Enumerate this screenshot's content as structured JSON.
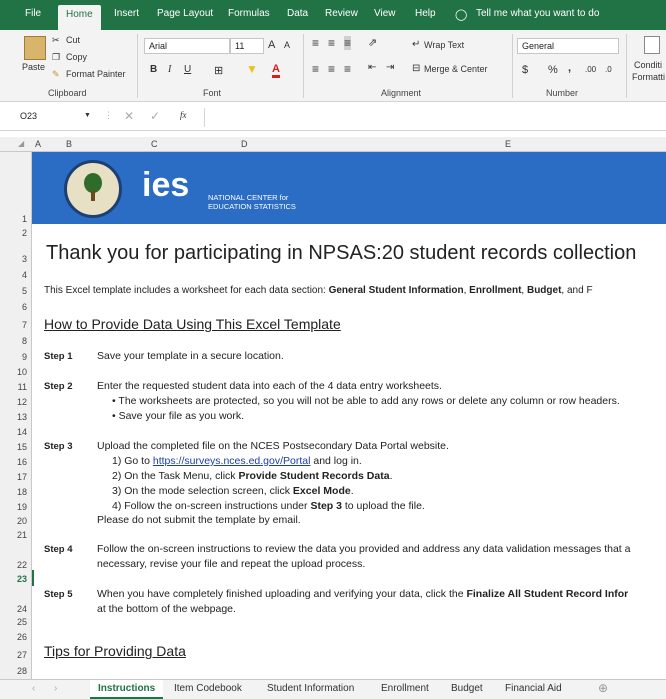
{
  "menu": {
    "tabs": [
      "File",
      "Home",
      "Insert",
      "Page Layout",
      "Formulas",
      "Data",
      "Review",
      "View",
      "Help"
    ],
    "tell_me": "Tell me what you want to do"
  },
  "ribbon": {
    "clipboard": {
      "paste": "Paste",
      "cut": "Cut",
      "copy": "Copy",
      "format_painter": "Format Painter",
      "label": "Clipboard"
    },
    "font": {
      "name": "Arial",
      "size": "11",
      "grow": "A",
      "shrink": "A",
      "bold": "B",
      "italic": "I",
      "underline": "U",
      "label": "Font"
    },
    "alignment": {
      "wrap_text": "Wrap Text",
      "merge_center": "Merge & Center",
      "label": "Alignment"
    },
    "number": {
      "format": "General",
      "currency": "$",
      "percent": "%",
      "comma": ",",
      "label": "Number"
    },
    "styles": {
      "conditional": "Conditi",
      "formatting": "Formatti"
    }
  },
  "formula_bar": {
    "cell_ref": "O23",
    "fx": "fx",
    "value": ""
  },
  "columns": [
    "A",
    "B",
    "C",
    "D",
    "E"
  ],
  "rows": [
    "1",
    "2",
    "3",
    "4",
    "5",
    "6",
    "7",
    "8",
    "9",
    "10",
    "11",
    "12",
    "13",
    "14",
    "15",
    "16",
    "17",
    "18",
    "19",
    "20",
    "21",
    "22",
    "23",
    "24",
    "25",
    "26",
    "27",
    "28"
  ],
  "sheet": {
    "logo_text": "ies",
    "logo_sub1": "NATIONAL CENTER for",
    "logo_sub2": "EDUCATION STATISTICS",
    "title": "Thank you for participating in NPSAS:20 student records collection",
    "intro_pre": "This Excel template includes a worksheet for each data section: ",
    "intro_s1": "General Student Information",
    "intro_c1": ", ",
    "intro_s2": "Enrollment",
    "intro_c2": ", ",
    "intro_s3": "Budget",
    "intro_c3": ", and F",
    "section1": "How to Provide Data Using This Excel Template",
    "step1_label": "Step 1",
    "step1_text": "Save your template in a secure location.",
    "step2_label": "Step 2",
    "step2_text": "Enter the requested student data into each of the 4 data entry worksheets.",
    "step2_b1": "• The worksheets are protected, so you will not be able to add any rows or delete any column or row headers.",
    "step2_b2": "• Save your file as you work.",
    "step3_label": "Step 3",
    "step3_text": "Upload the completed file on the NCES Postsecondary Data Portal website.",
    "step3_1_pre": "1) Go to ",
    "step3_1_link": "https://surveys.nces.ed.gov/Portal",
    "step3_1_post": " and log in.",
    "step3_2_pre": "2) On the Task Menu, click ",
    "step3_2_bold": "Provide Student Records Data",
    "step3_2_post": ".",
    "step3_3_pre": "3) On the mode selection screen, click ",
    "step3_3_bold": "Excel Mode",
    "step3_3_post": ".",
    "step3_4_pre": "4) Follow the on-screen instructions under ",
    "step3_4_bold": "Step 3",
    "step3_4_post": " to upload the file.",
    "step3_note": "Please do not submit the template by email.",
    "step4_label": "Step 4",
    "step4_text": "Follow the on-screen instructions to review the data you provided and address any data validation messages that a",
    "step4_text2": "necessary, revise your file and repeat the upload process.",
    "step5_label": "Step 5",
    "step5_pre": "When you have completely finished uploading and verifying your data, click the ",
    "step5_bold": "Finalize All Student Record Infor",
    "step5_text2": "at the bottom of the webpage.",
    "section2": "Tips for Providing Data"
  },
  "sheet_tabs": [
    "Instructions",
    "Item Codebook",
    "Student Information",
    "Enrollment",
    "Budget",
    "Financial Aid"
  ],
  "colors": {
    "excel_green": "#217346",
    "banner_blue": "#2b6cc4"
  }
}
